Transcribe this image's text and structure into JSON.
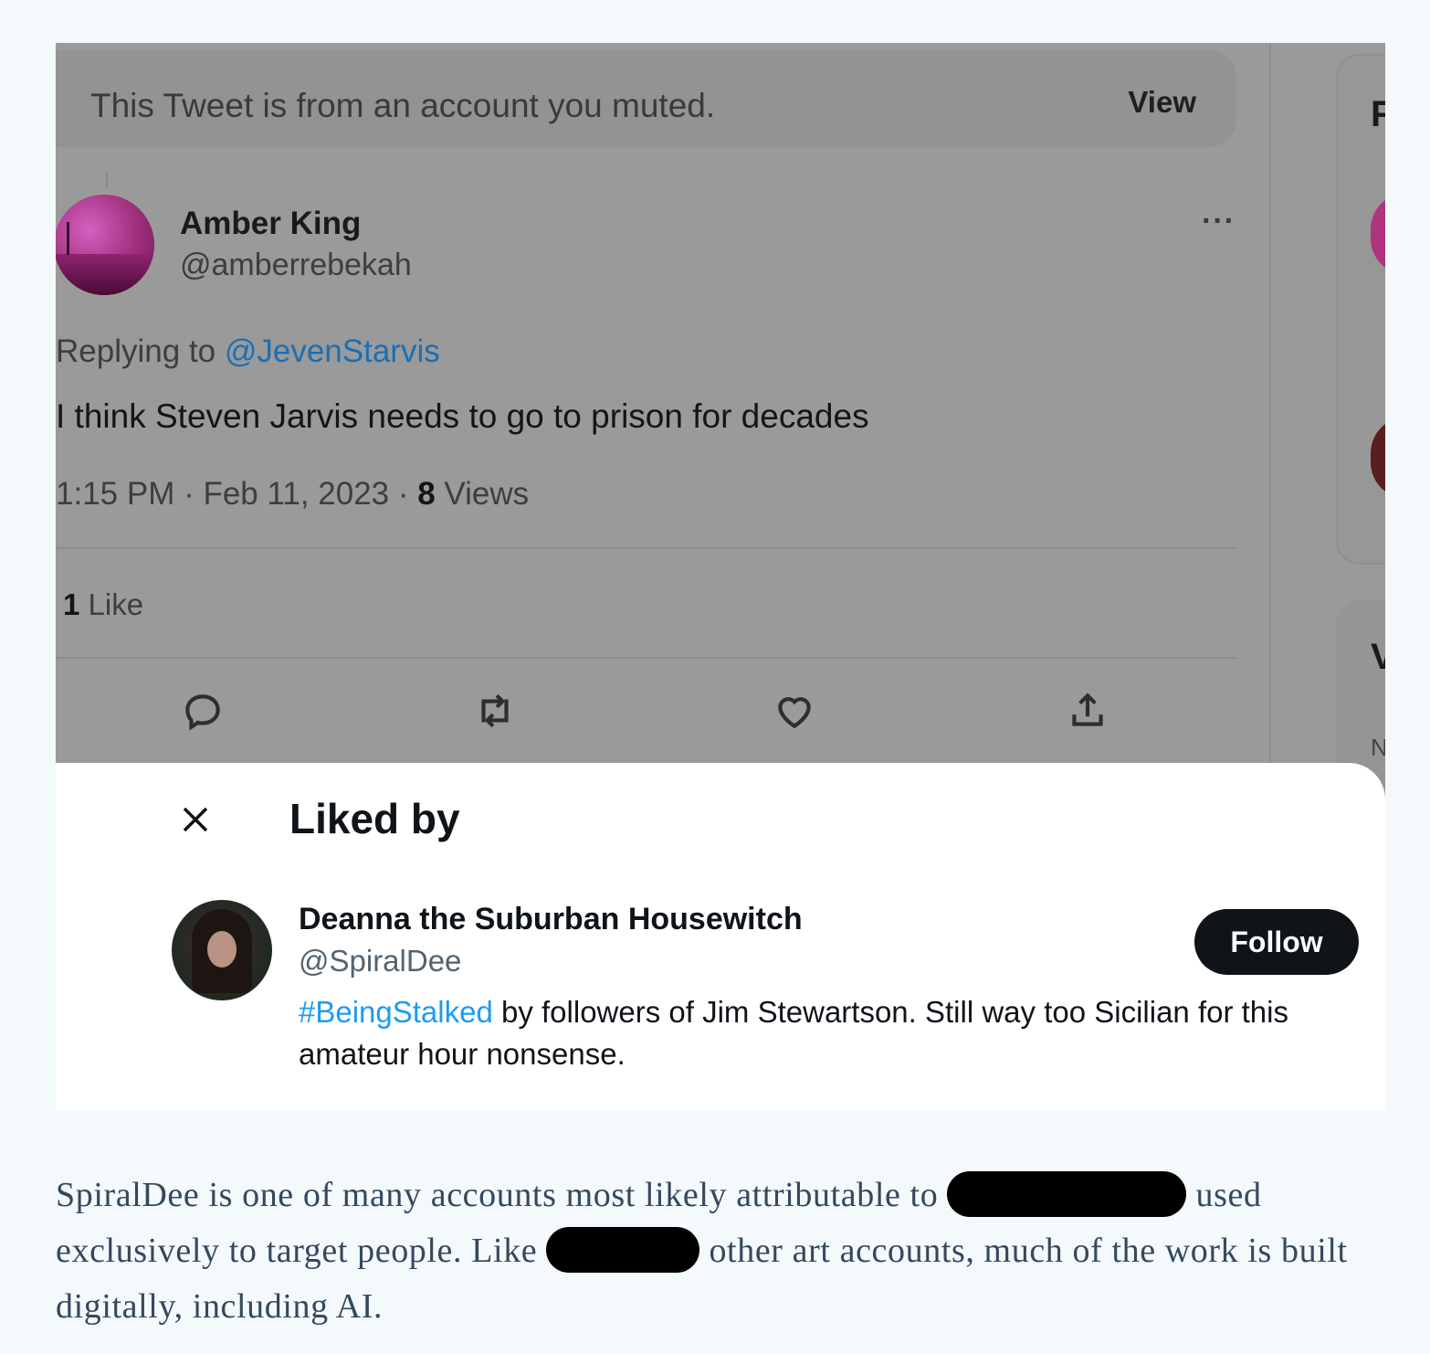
{
  "tweet": {
    "muted_notice": "This Tweet is from an account you muted.",
    "view_label": "View",
    "author_name": "Amber King",
    "author_handle": "@amberrebekah",
    "more_glyph": "···",
    "replying_prefix": "Replying to ",
    "replying_mention": "@JevenStarvis",
    "text": "I think Steven Jarvis needs to go to prison for decades",
    "time": "1:15 PM · Feb 11, 2023 · ",
    "views_count": "8",
    "views_label": " Views",
    "likes_count": "1",
    "likes_label": " Like"
  },
  "sidebar_fragments": {
    "letter_1": "F",
    "letter_2": "V",
    "letter_3": "N"
  },
  "liked_by_modal": {
    "title": "Liked by",
    "user": {
      "name": "Deanna the Suburban Housewitch",
      "handle": "@SpiralDee",
      "follow_label": "Follow",
      "bio_hashtag": "#BeingStalked",
      "bio_text": " by followers of Jim Stewartson. Still way too Sicilian for this amateur hour nonsense."
    }
  },
  "caption": {
    "part1": "SpiralDee is one of many accounts most likely attributable to ",
    "part2": " used exclusively to target people. Like ",
    "part3": " other art accounts, much of the work is built digitally, including AI."
  },
  "colors": {
    "overlay_gray": "#9a9a9a",
    "link_blue": "#1d9bf0",
    "follow_bg": "#0f1419",
    "caption_text": "#34495e",
    "page_bg": "#f4f9fc"
  }
}
